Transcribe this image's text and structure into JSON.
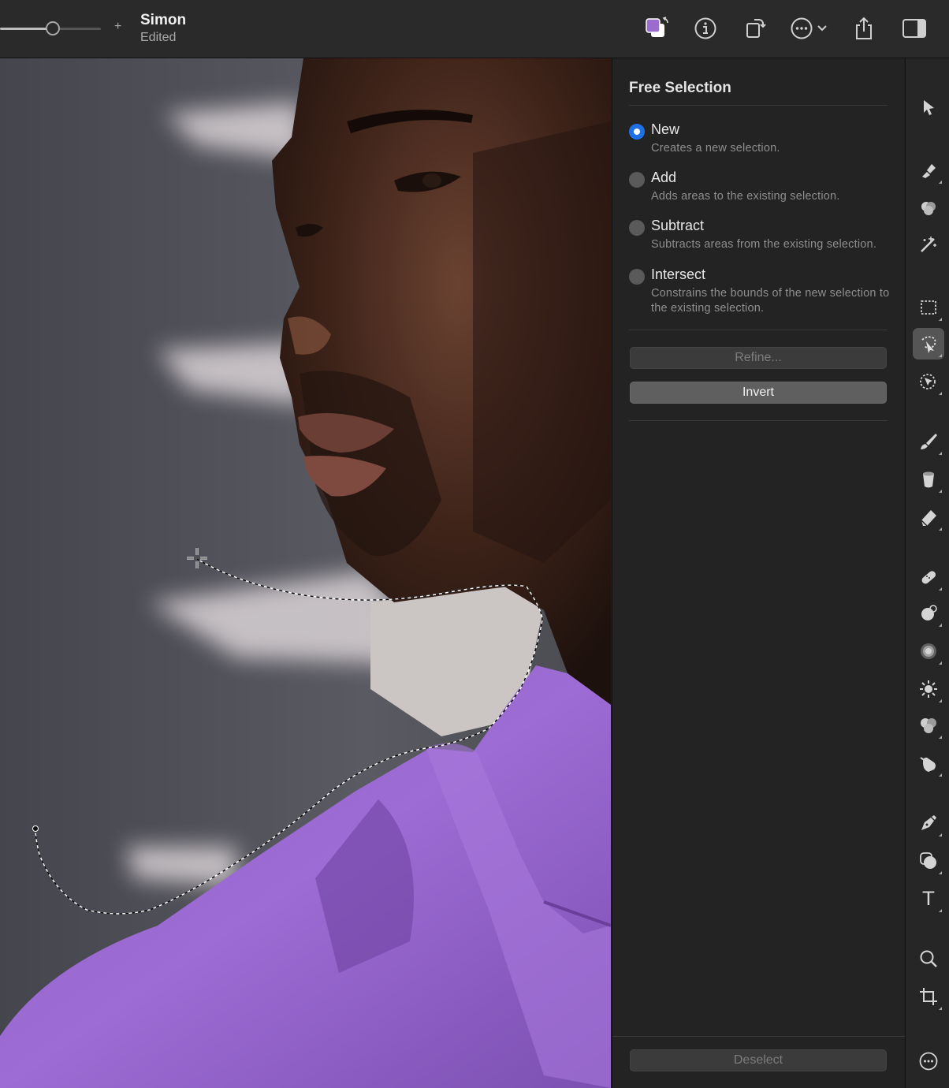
{
  "titlebar": {
    "zoom_plus": "+",
    "doc_title": "Simon",
    "doc_status": "Edited",
    "buttons": [
      "color-swap",
      "info",
      "rotate",
      "more-options",
      "share",
      "sidebar-toggle"
    ],
    "colors": {
      "foreground_swatch": "#9b6bd0",
      "background_swatch": "#ffffff"
    }
  },
  "inspector": {
    "title": "Free Selection",
    "options": [
      {
        "label": "New",
        "desc": "Creates a new selection.",
        "selected": true
      },
      {
        "label": "Add",
        "desc": "Adds areas to the existing selection.",
        "selected": false
      },
      {
        "label": "Subtract",
        "desc": "Subtracts areas from the existing selection.",
        "selected": false
      },
      {
        "label": "Intersect",
        "desc": "Constrains the bounds of the new selection to the existing selection.",
        "selected": false
      }
    ],
    "refine_label": "Refine...",
    "invert_label": "Invert",
    "deselect_label": "Deselect",
    "accent": "#1f6fe5"
  },
  "toolrail": {
    "tools": [
      "arrange-tool-icon",
      "paint-selection-icon",
      "color-adjust-icon",
      "magic-wand-icon",
      "rect-select-icon",
      "free-select-icon",
      "smart-select-icon",
      "brush-icon",
      "paint-bucket-icon",
      "eraser-icon",
      "repair-icon",
      "clone-icon",
      "blur-icon",
      "light-icon",
      "color-brush-icon",
      "smudge-icon",
      "pen-icon",
      "shapes-icon",
      "text-icon",
      "zoom-icon",
      "crop-icon",
      "more-tools-icon"
    ],
    "active_tool": "free-select-icon",
    "text_tool_glyph": "T"
  }
}
